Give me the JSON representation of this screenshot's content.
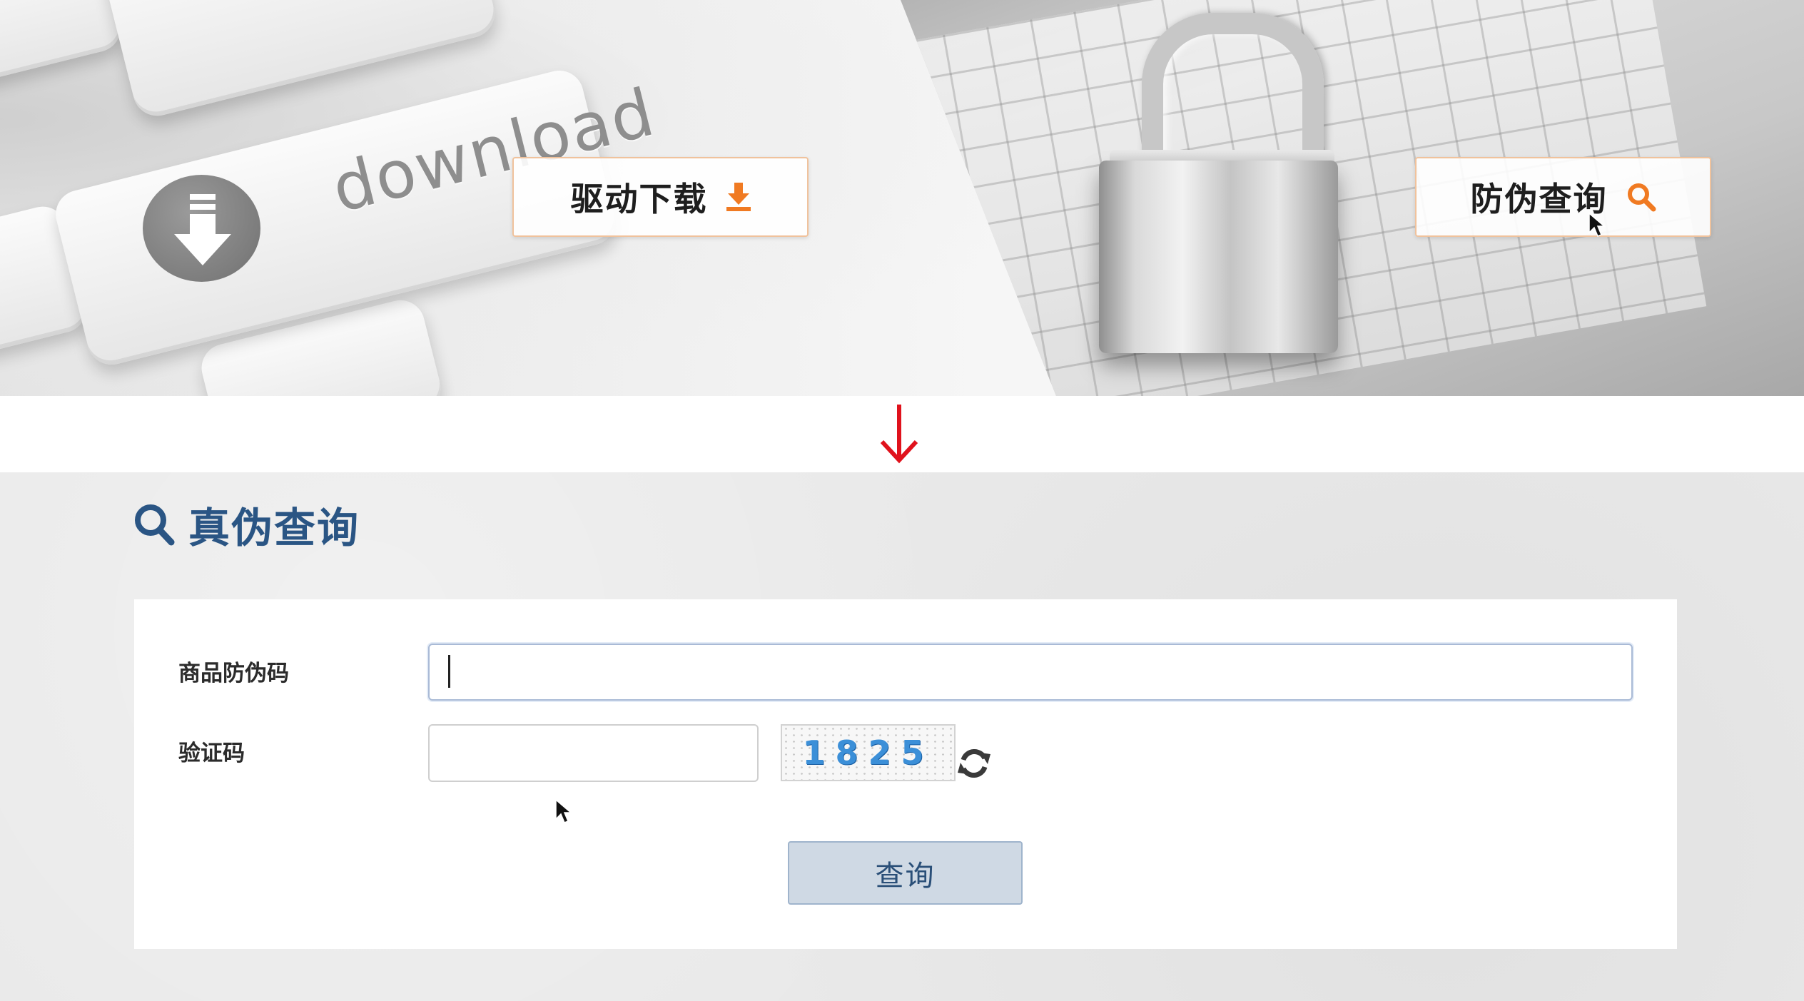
{
  "banner": {
    "keyboard_word": "download",
    "driver_button": {
      "label": "驱动下载",
      "icon": "download-icon",
      "icon_color": "#f07a22"
    },
    "verify_button": {
      "label": "防伪查询",
      "icon": "search-icon",
      "icon_color": "#f07a22"
    }
  },
  "transition": {
    "arrow": "down-arrow-icon",
    "color": "#e0121c"
  },
  "page": {
    "title": "真伪查询",
    "title_color": "#2a5584",
    "icon": "search-icon"
  },
  "form": {
    "code_label": "商品防伪码",
    "code_value": "",
    "captcha_label": "验证码",
    "captcha_value": "",
    "captcha_image_text": "1825",
    "refresh_icon": "refresh-icon",
    "submit_label": "查询",
    "submit_color": "#cfd9e4"
  }
}
